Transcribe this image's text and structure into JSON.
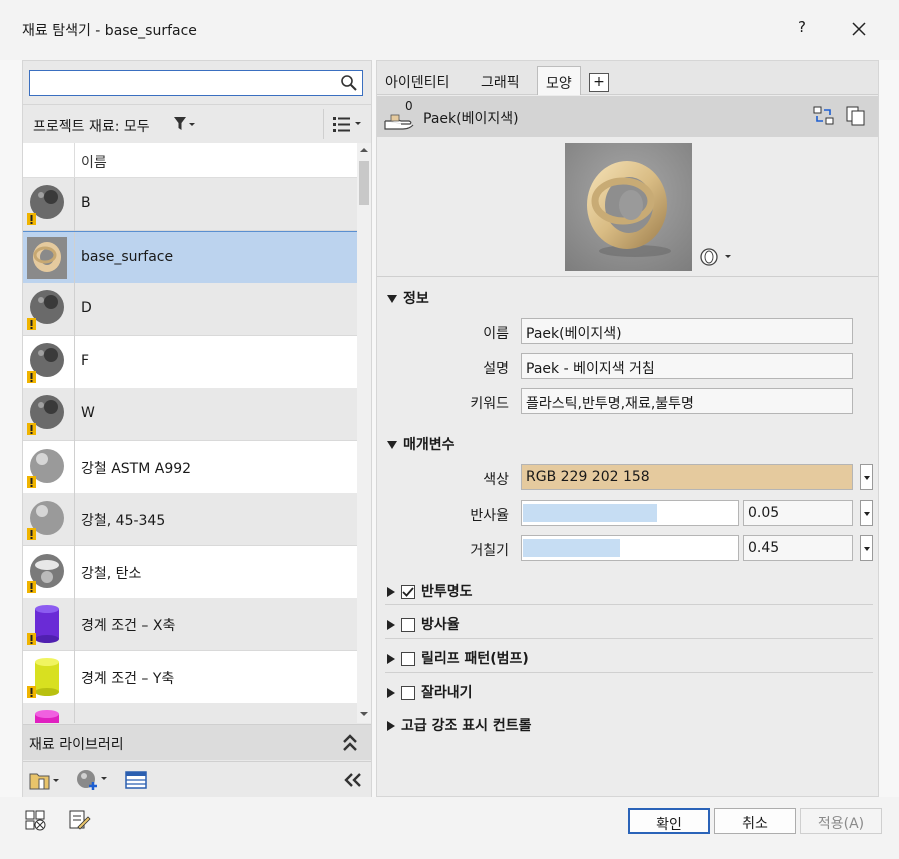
{
  "window": {
    "title": "재료 탐색기 - base_surface",
    "help_label": "?"
  },
  "search": {
    "placeholder": "",
    "value": ""
  },
  "filter": {
    "label": "프로젝트 재료: 모두"
  },
  "list": {
    "column_name": "이름",
    "items": [
      {
        "label": "B",
        "thumb": "gray-sphere",
        "warn": true
      },
      {
        "label": "base_surface",
        "thumb": "gold-ring",
        "warn": false,
        "selected": true
      },
      {
        "label": "D",
        "thumb": "gray-sphere",
        "warn": true
      },
      {
        "label": "F",
        "thumb": "gray-sphere",
        "warn": true
      },
      {
        "label": "W",
        "thumb": "gray-sphere",
        "warn": true
      },
      {
        "label": "강철 ASTM A992",
        "thumb": "steel-sphere",
        "warn": true
      },
      {
        "label": "강철, 45-345",
        "thumb": "steel-sphere",
        "warn": true
      },
      {
        "label": "강철, 탄소",
        "thumb": "chrome-sphere",
        "warn": true
      },
      {
        "label": "경계 조건 – X축",
        "thumb": "purple-cylinder",
        "warn": true
      },
      {
        "label": "경계 조건 – Y축",
        "thumb": "yellow-cylinder",
        "warn": true
      },
      {
        "label": "",
        "thumb": "magenta-cylinder",
        "warn": false
      }
    ]
  },
  "library": {
    "label": "재료 라이브러리"
  },
  "tabs": [
    {
      "label": "아이덴티티",
      "active": false
    },
    {
      "label": "그래픽",
      "active": false
    },
    {
      "label": "모양",
      "active": true
    }
  ],
  "tab_add_label": "+",
  "asset": {
    "count": "0",
    "name": "Paek(베이지색)"
  },
  "info": {
    "header": "정보",
    "name_label": "이름",
    "name_value": "Paek(베이지색)",
    "desc_label": "설명",
    "desc_value": "Paek - 베이지색 거침",
    "keyword_label": "키워드",
    "keyword_value": "플라스틱,반투명,재료,불투명"
  },
  "params": {
    "header": "매개변수",
    "color_label": "색상",
    "color_value": "RGB 229 202 158",
    "color_hex": "#e5ca9e",
    "reflect_label": "반사율",
    "reflect_value": "0.05",
    "reflect_fraction": 0.62,
    "rough_label": "거칠기",
    "rough_value": "0.45",
    "rough_fraction": 0.45
  },
  "sections": [
    {
      "label": "반투명도",
      "checked": true,
      "has_checkbox": true
    },
    {
      "label": "방사율",
      "checked": false,
      "has_checkbox": true
    },
    {
      "label": "릴리프 패턴(범프)",
      "checked": false,
      "has_checkbox": true
    },
    {
      "label": "잘라내기",
      "checked": false,
      "has_checkbox": true
    },
    {
      "label": "고급 강조 표시 컨트롤",
      "checked": false,
      "has_checkbox": false
    }
  ],
  "buttons": {
    "ok": "확인",
    "cancel": "취소",
    "apply": "적용(A)"
  }
}
